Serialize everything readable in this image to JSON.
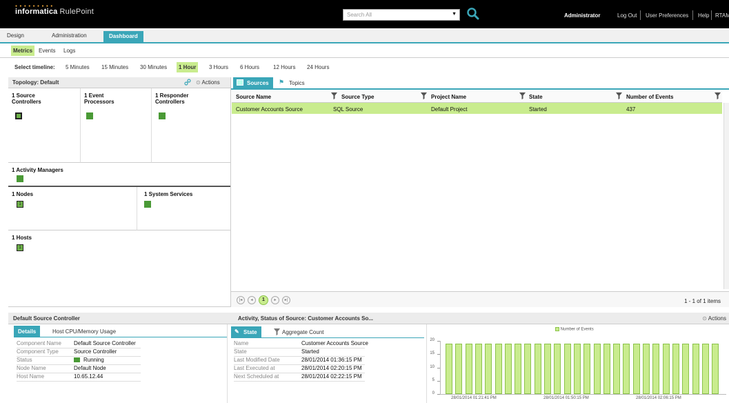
{
  "header": {
    "logo_brand": "informatica",
    "logo_product": "RulePoint",
    "search_placeholder": "Search All",
    "user": "Administrator",
    "links": [
      "Log Out",
      "User Preferences",
      "Help",
      "RTAM"
    ]
  },
  "main_tabs": [
    "Design",
    "Administration",
    "Dashboard"
  ],
  "active_main_tab": "Dashboard",
  "sub_tabs": [
    "Metrics",
    "Events",
    "Logs"
  ],
  "active_sub_tab": "Metrics",
  "timeline": {
    "label": "Select timeline:",
    "options": [
      "5 Minutes",
      "15 Minutes",
      "30 Minutes",
      "1 Hour",
      "3 Hours",
      "6 Hours",
      "12 Hours",
      "24 Hours"
    ],
    "active": "1 Hour"
  },
  "topology": {
    "title": "Topology: Default",
    "actions_label": "Actions",
    "source_controllers": "1 Source Controllers",
    "event_processors": "1 Event Processors",
    "responder_controllers": "1 Responder Controllers",
    "activity_managers": "1 Activity Managers",
    "nodes": "1 Nodes",
    "system_services": "1 System Services",
    "hosts": "1 Hosts",
    "node_count": "1",
    "host_count": "1"
  },
  "sources_panel": {
    "tabs": [
      "Sources",
      "Topics"
    ],
    "columns": [
      "Source Name",
      "Source Type",
      "Project Name",
      "State",
      "Number of Events"
    ],
    "rows": [
      [
        "Customer Accounts Source",
        "SQL Source",
        "Default Project",
        "Started",
        "437"
      ]
    ],
    "current_page": "1",
    "items_summary": "1 - 1 of 1 items"
  },
  "controller_panel": {
    "title": "Default Source Controller",
    "tabs": [
      "Details",
      "Host CPU/Memory Usage"
    ],
    "details": [
      {
        "k": "Component Name",
        "v": "Default Source Controller"
      },
      {
        "k": "Component Type",
        "v": "Source Controller"
      },
      {
        "k": "Status",
        "v": "Running"
      },
      {
        "k": "Node Name",
        "v": "Default Node"
      },
      {
        "k": "Host Name",
        "v": "10.65.12.44"
      }
    ]
  },
  "activity_panel": {
    "title": "Activity, Status of Source: Customer Accounts So...",
    "actions_label": "Actions",
    "tabs": [
      "State",
      "Aggregate Count"
    ],
    "details": [
      {
        "k": "Name",
        "v": "Customer Accounts Source"
      },
      {
        "k": "State",
        "v": "Started"
      },
      {
        "k": "Last Modified Date",
        "v": "28/01/2014 01:36:15 PM"
      },
      {
        "k": "Last Executed at",
        "v": "28/01/2014 02:20:15 PM"
      },
      {
        "k": "Next Scheduled at",
        "v": "28/01/2014 02:22:15 PM"
      }
    ]
  },
  "chart_data": {
    "type": "bar",
    "series": [
      {
        "name": "Number of Events",
        "values": [
          19,
          19,
          19,
          19,
          19,
          19,
          19,
          19,
          19,
          19,
          19,
          19,
          19,
          19,
          19,
          19,
          19,
          19,
          19,
          19,
          19,
          19,
          19,
          19,
          19,
          19,
          19,
          19
        ]
      }
    ],
    "yticks": [
      "0",
      "5",
      "10",
      "15",
      "20"
    ],
    "ylim": [
      0,
      20
    ],
    "xtick_labels": [
      "28/01/2014 01:21:41 PM",
      "28/01/2014 01:50:15 PM",
      "28/01/2014 02:06:15 PM"
    ],
    "legend_position": "top-center",
    "colors": {
      "bar": "#c9ec8e",
      "border": "#8bc34a"
    }
  },
  "colors": {
    "accent": "#3aa6b8",
    "highlight": "#c9ec8e",
    "status_green": "#4a9a36"
  }
}
